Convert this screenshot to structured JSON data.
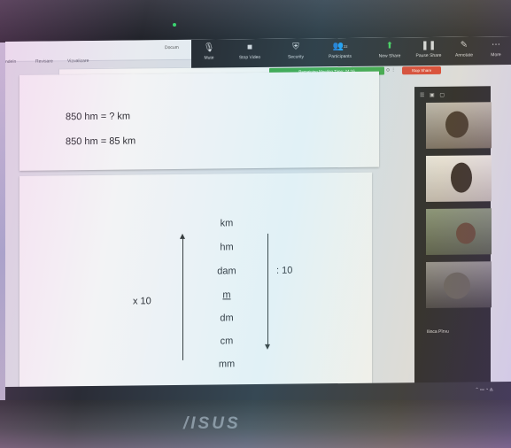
{
  "word": {
    "doc_title": "Docum",
    "tabs": [
      "ndeln",
      "Revisare",
      "Vizualizare"
    ]
  },
  "zoom": {
    "buttons": [
      {
        "label": "Mute",
        "icon": "microphone-icon"
      },
      {
        "label": "Stop Video",
        "icon": "video-camera-icon"
      },
      {
        "label": "Security",
        "icon": "shield-icon"
      },
      {
        "label": "Participants",
        "icon": "participants-icon",
        "count": "22"
      },
      {
        "label": "New Share",
        "icon": "share-screen-icon"
      },
      {
        "label": "Pause Share",
        "icon": "pause-icon"
      },
      {
        "label": "Annotate",
        "icon": "pencil-icon"
      },
      {
        "label": "More",
        "icon": "more-icon"
      }
    ],
    "banner": "Remaining Meeting Time: 24:16",
    "stop_share": "Stop Share",
    "gallery_footer": "Ilinca Pîrvu"
  },
  "slide1": {
    "question": "850 hm = ? km",
    "answer": "850 hm =  85 km"
  },
  "slide2": {
    "units": [
      "km",
      "hm",
      "dam",
      "m",
      "dm",
      "cm",
      "mm"
    ],
    "multiply_label": "x 10",
    "divide_label": ": 10"
  },
  "laptop": {
    "brand": "/ISUS"
  },
  "colors": {
    "zoom_green": "#3aa443",
    "stop_red": "#d8402f"
  }
}
